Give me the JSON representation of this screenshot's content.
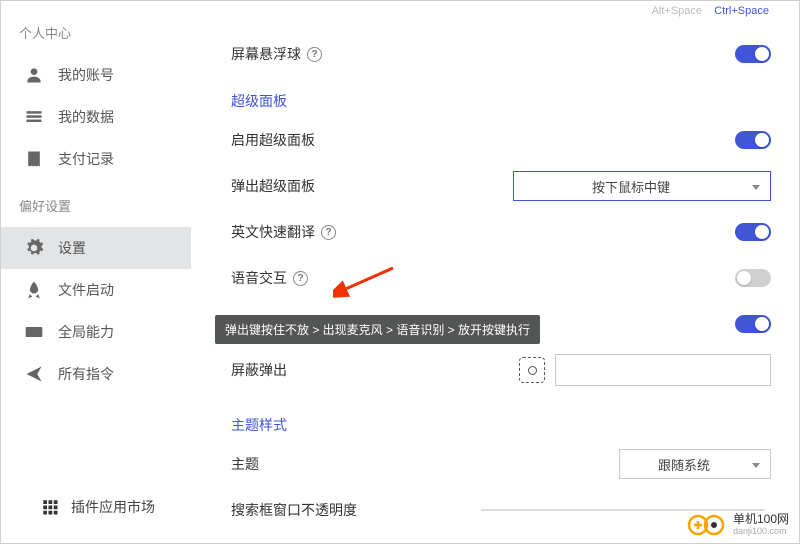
{
  "hotkeys": {
    "alt": "Alt+Space",
    "ctrl": "Ctrl+Space"
  },
  "sidebar": {
    "section1": "个人中心",
    "section2": "偏好设置",
    "items": [
      {
        "label": "我的账号"
      },
      {
        "label": "我的数据"
      },
      {
        "label": "支付记录"
      },
      {
        "label": "设置"
      },
      {
        "label": "文件启动"
      },
      {
        "label": "全局能力"
      },
      {
        "label": "所有指令"
      }
    ],
    "plugin": "插件应用市场"
  },
  "settings": {
    "floating_ball": "屏幕悬浮球",
    "section_panel": "超级面板",
    "enable_panel": "启用超级面板",
    "popup_panel": "弹出超级面板",
    "popup_panel_value": "按下鼠标中键",
    "english_quick": "英文快速翻译",
    "voice": "语音交互",
    "voice_hint": "弹出键按住不放 > 出现麦克风 > 语音识别 > 放开按键执行",
    "screen_popup": "屏蔽弹出",
    "section_theme": "主题样式",
    "theme": "主题",
    "theme_value": "跟随系统",
    "search_opacity": "搜索框窗口不透明度"
  },
  "watermark": {
    "cn": "单机100网",
    "en": "danji100.com"
  }
}
